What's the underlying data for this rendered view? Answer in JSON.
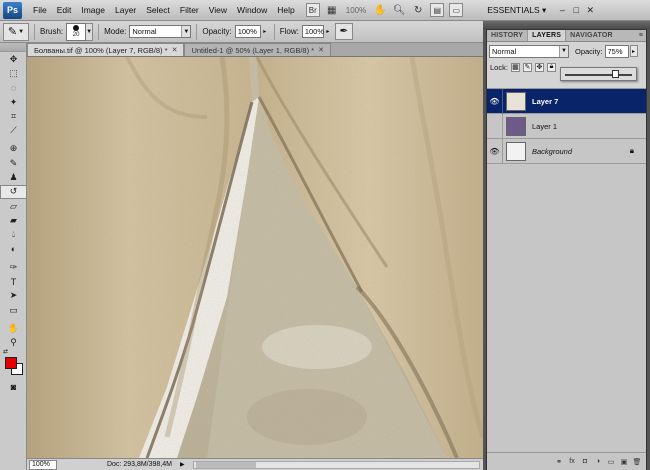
{
  "app": {
    "logo": "Ps",
    "menu": [
      "File",
      "Edit",
      "Image",
      "Layer",
      "Select",
      "Filter",
      "View",
      "Window",
      "Help"
    ],
    "zoom_display": "100%",
    "workspace": "ESSENTIALS",
    "workspace_caret": "▾",
    "window_controls": [
      "–",
      "□",
      "✕"
    ]
  },
  "options_bar": {
    "brush_label": "Brush:",
    "brush_size": "20",
    "mode_label": "Mode:",
    "mode_value": "Normal",
    "opacity_label": "Opacity:",
    "opacity_value": "100%",
    "flow_label": "Flow:",
    "flow_value": "100%"
  },
  "doc_tabs": [
    {
      "label": "Болваны.tif @ 100% (Layer 7, RGB/8) *",
      "close": "✕",
      "active": true
    },
    {
      "label": "Untitled-1 @ 50% (Layer 1, RGB/8) *",
      "close": "✕",
      "active": false
    }
  ],
  "status_bar": {
    "zoom": "100%",
    "doc_info": "Doc: 293,8M/398,4M"
  },
  "colors": {
    "foreground": "#e40000",
    "background": "#ffffff",
    "selection": "#0a246a"
  },
  "layers_panel": {
    "tabs": [
      "HISTORY",
      "LAYERS",
      "NAVIGATOR"
    ],
    "active_tab": "LAYERS",
    "blend_mode": "Normal",
    "opacity_label": "Opacity:",
    "opacity_value": "75%",
    "opacity_slider_fraction": 0.75,
    "lock_label": "Lock:",
    "layers": [
      {
        "name": "Layer 7",
        "visible": true,
        "selected": true,
        "thumb_color": "#e8e2d8"
      },
      {
        "name": "Layer 1",
        "visible": false,
        "selected": false,
        "thumb_color": "#6e5a8a"
      },
      {
        "name": "Background",
        "visible": true,
        "selected": false,
        "thumb_color": "#f2f2f2",
        "locked": true
      }
    ]
  },
  "icons": {
    "toolbox": [
      "move-icon",
      "marquee-icon",
      "lasso-icon",
      "magic-wand-icon",
      "crop-icon",
      "eyedropper-icon",
      "healing-icon",
      "brush-icon",
      "clone-stamp-icon",
      "history-brush-icon",
      "eraser-icon",
      "gradient-icon",
      "blur-icon",
      "dodge-icon",
      "pen-icon",
      "type-icon",
      "path-select-icon",
      "rectangle-icon",
      "hand-icon",
      "zoom-icon"
    ]
  }
}
